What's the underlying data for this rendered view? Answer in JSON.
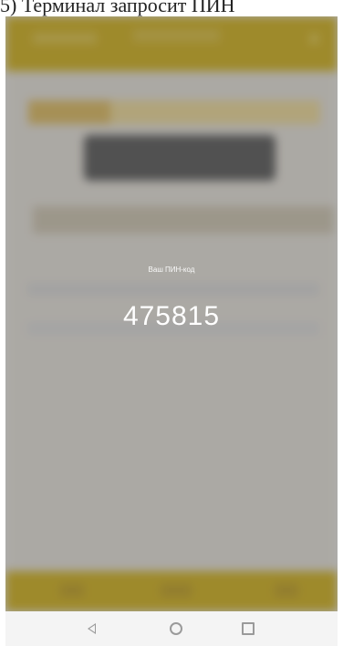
{
  "document": {
    "caption": "5)      Терминал запросит ПИН"
  },
  "app": {
    "close_glyph": "×"
  },
  "pin_dialog": {
    "label": "Ваш ПИН-код",
    "code": "475815"
  },
  "navigation_bar": {
    "back_icon": "back-triangle-icon",
    "home_icon": "home-circle-icon",
    "recents_icon": "recents-square-icon"
  }
}
